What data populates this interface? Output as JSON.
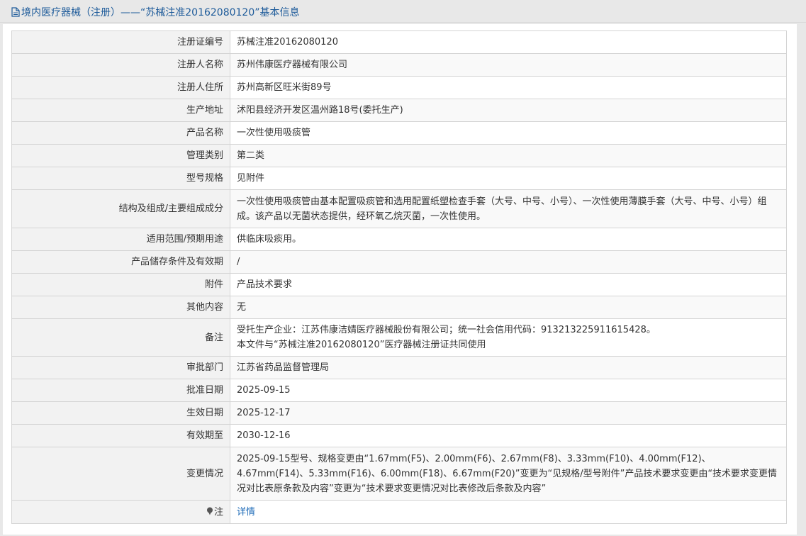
{
  "header": {
    "title": "境内医疗器械（注册）——“苏械注准20162080120”基本信息"
  },
  "rows": [
    {
      "label": "注册证编号",
      "value": "苏械注准20162080120"
    },
    {
      "label": "注册人名称",
      "value": "苏州伟康医疗器械有限公司"
    },
    {
      "label": "注册人住所",
      "value": "苏州高新区旺米街89号"
    },
    {
      "label": "生产地址",
      "value": "沭阳县经济开发区温州路18号(委托生产)"
    },
    {
      "label": "产品名称",
      "value": "一次性使用吸痰管"
    },
    {
      "label": "管理类别",
      "value": "第二类"
    },
    {
      "label": "型号规格",
      "value": "见附件"
    },
    {
      "label": "结构及组成/主要组成成分",
      "value": "一次性使用吸痰管由基本配置吸痰管和选用配置纸塑检查手套（大号、中号、小号）、一次性使用薄膜手套（大号、中号、小号）组成。该产品以无菌状态提供，经环氧乙烷灭菌，一次性使用。"
    },
    {
      "label": "适用范围/预期用途",
      "value": "供临床吸痰用。"
    },
    {
      "label": "产品储存条件及有效期",
      "value": "/"
    },
    {
      "label": "附件",
      "value": "产品技术要求"
    },
    {
      "label": "其他内容",
      "value": "无"
    },
    {
      "label": "备注",
      "value": "受托生产企业：江苏伟康洁婧医疗器械股份有限公司；统一社会信用代码：913213225911615428。\n本文件与“苏械注准20162080120”医疗器械注册证共同使用"
    },
    {
      "label": "审批部门",
      "value": "江苏省药品监督管理局"
    },
    {
      "label": "批准日期",
      "value": "2025-09-15"
    },
    {
      "label": "生效日期",
      "value": "2025-12-17"
    },
    {
      "label": "有效期至",
      "value": "2030-12-16"
    },
    {
      "label": "变更情况",
      "value": "2025-09-15型号、规格变更由“1.67mm(F5)、2.00mm(F6)、2.67mm(F8)、3.33mm(F10)、4.00mm(F12)、4.67mm(F14)、5.33mm(F16)、6.00mm(F18)、6.67mm(F20)”变更为“见规格/型号附件”产品技术要求变更由“技术要求变更情况对比表原条款及内容”变更为“技术要求变更情况对比表修改后条款及内容”"
    }
  ],
  "note": {
    "label": "注",
    "link_text": "详情"
  },
  "icons": {
    "header": "document-icon",
    "note": "pin-icon"
  },
  "colors": {
    "title": "#1e5b9a",
    "link": "#1e6bb8",
    "label_bg": "#f2f2f2"
  }
}
